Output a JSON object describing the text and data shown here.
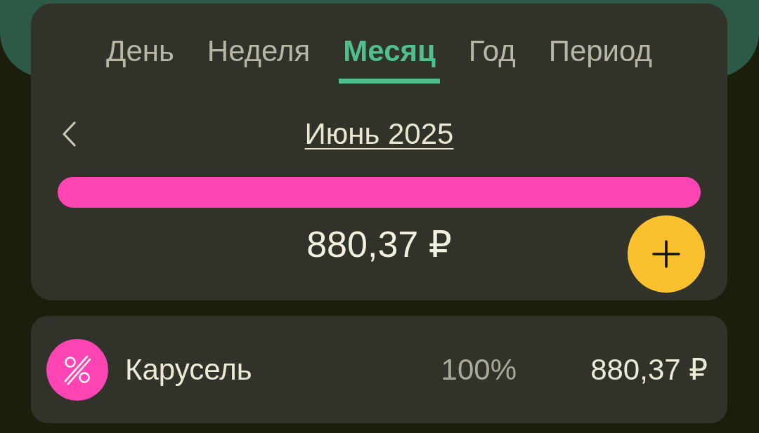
{
  "tabs": [
    {
      "label": "День",
      "selected": false
    },
    {
      "label": "Неделя",
      "selected": false
    },
    {
      "label": "Месяц",
      "selected": true
    },
    {
      "label": "Год",
      "selected": false
    },
    {
      "label": "Период",
      "selected": false
    }
  ],
  "period": {
    "label": "Июнь 2025"
  },
  "total": "880,37 ₽",
  "categories": [
    {
      "name": "Карусель",
      "share": "100%",
      "amount": "880,37 ₽",
      "color": "#ff45b4"
    }
  ]
}
